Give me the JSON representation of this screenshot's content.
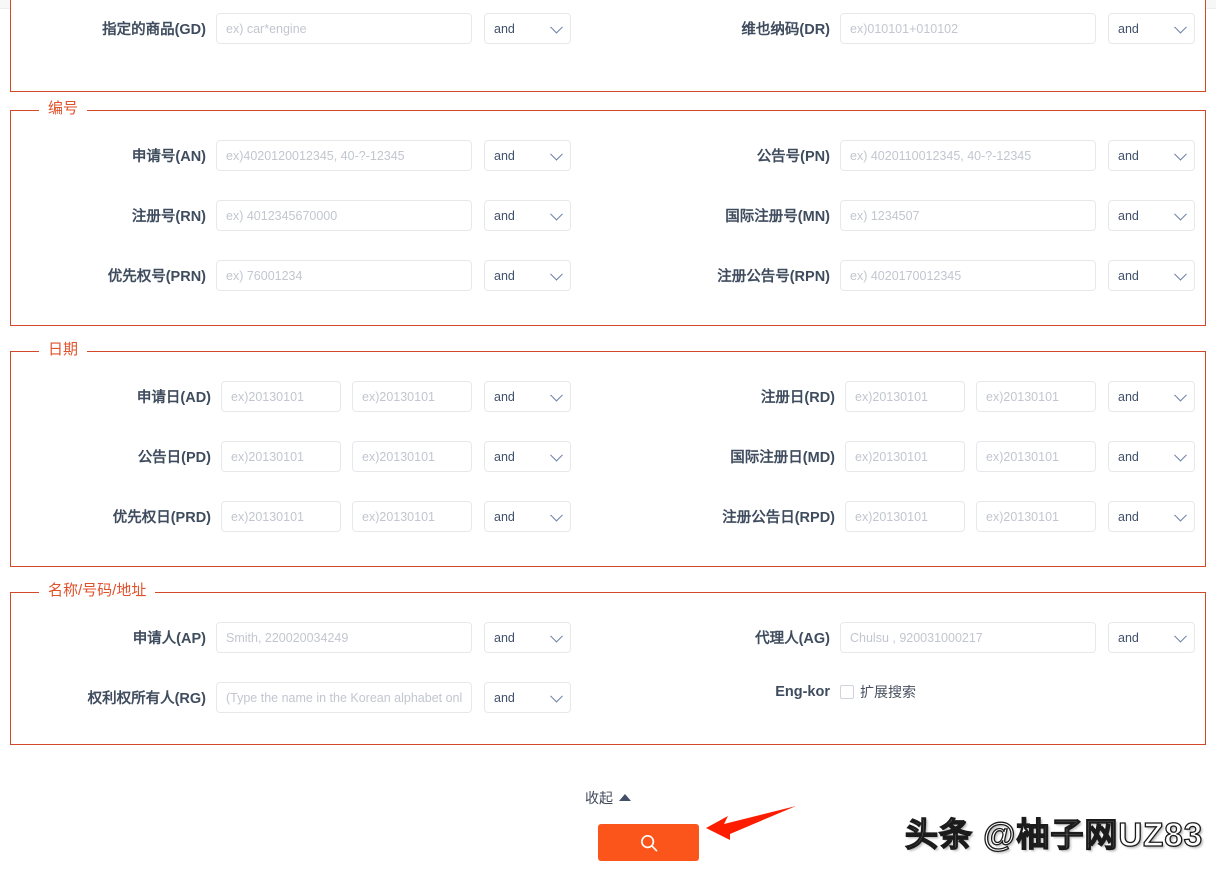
{
  "sections": [
    {
      "id": "clipped_top",
      "legend": "",
      "rows": [
        {
          "left": {
            "label": "指定的商品(GD)",
            "placeholder": "ex) car*engine",
            "value": "",
            "operator": "and"
          },
          "right": {
            "label": "维也纳码(DR)",
            "placeholder": "ex)010101+010102",
            "value": "",
            "operator": "and"
          }
        }
      ]
    },
    {
      "id": "numbers",
      "legend": "编号",
      "rows": [
        {
          "left": {
            "label": "申请号(AN)",
            "placeholder": "ex)4020120012345, 40-?-12345",
            "value": "",
            "operator": "and"
          },
          "right": {
            "label": "公告号(PN)",
            "placeholder": "ex) 4020110012345, 40-?-12345",
            "value": "",
            "operator": "and"
          }
        },
        {
          "left": {
            "label": "注册号(RN)",
            "placeholder": "ex) 4012345670000",
            "value": "",
            "operator": "and"
          },
          "right": {
            "label": "国际注册号(MN)",
            "placeholder": "ex) 1234507",
            "value": "",
            "operator": "and"
          }
        },
        {
          "left": {
            "label": "优先权号(PRN)",
            "placeholder": "ex) 76001234",
            "value": "",
            "operator": "and"
          },
          "right": {
            "label": "注册公告号(RPN)",
            "placeholder": "ex) 4020170012345",
            "value": "",
            "operator": "and"
          }
        }
      ]
    },
    {
      "id": "dates",
      "legend": "日期",
      "rows": [
        {
          "left": {
            "label": "申请日(AD)",
            "placeholder_from": "ex)20130101",
            "placeholder_to": "ex)20130101",
            "value_from": "",
            "value_to": "",
            "operator": "and"
          },
          "right": {
            "label": "注册日(RD)",
            "placeholder_from": "ex)20130101",
            "placeholder_to": "ex)20130101",
            "value_from": "",
            "value_to": "",
            "operator": "and"
          }
        },
        {
          "left": {
            "label": "公告日(PD)",
            "placeholder_from": "ex)20130101",
            "placeholder_to": "ex)20130101",
            "value_from": "",
            "value_to": "",
            "operator": "and"
          },
          "right": {
            "label": "国际注册日(MD)",
            "placeholder_from": "ex)20130101",
            "placeholder_to": "ex)20130101",
            "value_from": "",
            "value_to": "",
            "operator": "and"
          }
        },
        {
          "left": {
            "label": "优先权日(PRD)",
            "placeholder_from": "ex)20130101",
            "placeholder_to": "ex)20130101",
            "value_from": "",
            "value_to": "",
            "operator": "and"
          },
          "right": {
            "label": "注册公告日(RPD)",
            "placeholder_from": "ex)20130101",
            "placeholder_to": "ex)20130101",
            "value_from": "",
            "value_to": "",
            "operator": "and"
          }
        }
      ]
    },
    {
      "id": "names",
      "legend": "名称/号码/地址",
      "rows": [
        {
          "left": {
            "label": "申请人(AP)",
            "placeholder": "Smith, 220020034249",
            "value": "",
            "operator": "and"
          },
          "right": {
            "label": "代理人(AG)",
            "placeholder": "Chulsu , 920031000217",
            "value": "",
            "operator": "and"
          }
        },
        {
          "left": {
            "label": "权利权所有人(RG)",
            "placeholder": "(Type the name in the Korean alphabet only)",
            "value": "",
            "operator": "and"
          },
          "right": {
            "label": "Eng-kor",
            "checkbox_label": "扩展搜索",
            "checked": false
          }
        }
      ]
    }
  ],
  "footer": {
    "collapse_label": "收起",
    "search_button_icon": "search-icon",
    "arrow_annotation_color": "#fc1c00"
  },
  "watermark": {
    "text": "头条 @柚子网UZ83"
  },
  "colors": {
    "fieldset_border": "#d1482a",
    "legend_text": "#e0522c",
    "label_text": "#3f4c5e",
    "input_border": "#e6e8ec",
    "placeholder": "#c2c6cf",
    "search_button": "#fb551b",
    "arrow_red": "#fc1c00"
  }
}
